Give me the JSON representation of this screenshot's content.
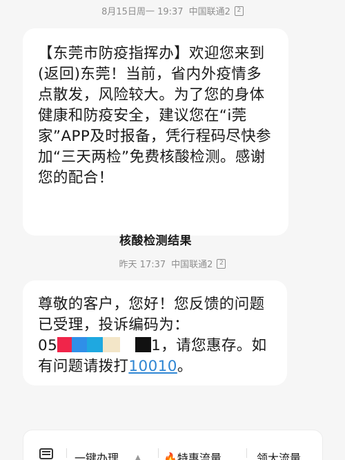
{
  "messages": [
    {
      "timestamp": "8月15日周一 19:37",
      "carrier": "中国联通2",
      "sim_badge": "2",
      "text": "【东莞市防疫指挥办】欢迎您来到(返回)东莞！当前，省内外疫情多点散发，风险较大。为了您的身体健康和防疫安全，建议您在“i莞家”APP及时报备，凭行程码尽快参加“三天两检”免费核酸检测。感谢您的配合！",
      "action_label": "核酸检测结果"
    },
    {
      "timestamp": "昨天 17:37",
      "carrier": "中国联通2",
      "sim_badge": "2",
      "text_part1": "尊敬的客户，您好！您反馈的问题已受理，投诉编码为：",
      "code_prefix": "05",
      "code_suffix": "1",
      "text_part2": "，请您惠存。如有问题请拨打",
      "phone_link": "10010",
      "text_part3": "。",
      "redaction_colors": [
        "#f0254a",
        "#2f8fe8",
        "#1fa8e0",
        "#f3e6c8",
        "#ffffff",
        "#111111"
      ]
    }
  ],
  "bottom_menu": {
    "keyboard_icon": "keyboard-icon",
    "items": [
      {
        "label": "一键办理"
      },
      {
        "label": "🔥特惠流量"
      },
      {
        "label": "领大流量"
      }
    ]
  }
}
